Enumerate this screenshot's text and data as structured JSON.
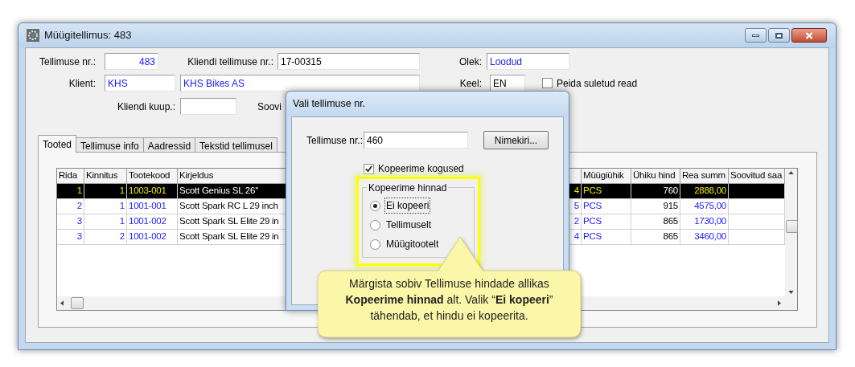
{
  "window": {
    "title": "Müügitellimus: 483"
  },
  "fields": {
    "order_no": {
      "label": "Tellimuse nr.:",
      "value": "483"
    },
    "client_order_no": {
      "label": "Kliendi tellimuse nr.:",
      "value": "17-00315"
    },
    "status": {
      "label": "Olek:",
      "value": "Loodud"
    },
    "client": {
      "label": "Klient:",
      "code": "KHS",
      "name": "KHS Bikes AS"
    },
    "language": {
      "label": "Keel:",
      "value": "EN"
    },
    "hide_closed": {
      "label": "Peida suletud read",
      "checked": false
    },
    "client_date": {
      "label": "Kliendi kuup.:"
    },
    "cut_label": "Soovi"
  },
  "tabs": [
    {
      "label": "Tooted",
      "selected": true
    },
    {
      "label": "Tellimuse info",
      "selected": false
    },
    {
      "label": "Aadressid",
      "selected": false
    },
    {
      "label": "Tekstid tellimusel",
      "selected": false
    }
  ],
  "table": {
    "columns": [
      {
        "label": "Rida",
        "kind": "count"
      },
      {
        "label": "Kinnitus",
        "kind": "count"
      },
      {
        "label": "Tootekood",
        "kind": "code"
      },
      {
        "label": "Kirjeldus",
        "kind": "text"
      },
      {
        "kind": "count"
      },
      {
        "label": "Müügiühik",
        "kind": "code"
      },
      {
        "label": "Ühiku hind",
        "kind": "price"
      },
      {
        "label": "Rea summ",
        "kind": "count"
      },
      {
        "label": "Soovitud saa",
        "kind": "text"
      }
    ],
    "rows": [
      {
        "selected": true,
        "cells": [
          "1",
          "1",
          "1003-001",
          "Scott Genius SL 26''",
          "4",
          "PCS",
          "760",
          "2888,00",
          ""
        ]
      },
      {
        "selected": false,
        "cells": [
          "2",
          "1",
          "1001-001",
          "Scott Spark RC L 29 inch",
          "5",
          "PCS",
          "915",
          "4575,00",
          ""
        ]
      },
      {
        "selected": false,
        "cells": [
          "3",
          "1",
          "1001-002",
          "Scott Spark SL Elite 29 in",
          "2",
          "PCS",
          "865",
          "1730,00",
          ""
        ]
      },
      {
        "selected": false,
        "cells": [
          "3",
          "2",
          "1001-002",
          "Scott Spark SL Elite 29 in",
          "4",
          "PCS",
          "865",
          "3460,00",
          ""
        ]
      }
    ]
  },
  "dialog": {
    "title": "Vali tellimuse nr.",
    "order_label": "Tellimuse nr.:",
    "order_value": "460",
    "list_button": "Nimekiri...",
    "copy_quantities": {
      "label": "Kopeerime kogused",
      "checked": true
    },
    "price_group": {
      "title": "Kopeerime hinnad",
      "options": [
        {
          "label": "Ei kopeeri",
          "selected": true
        },
        {
          "label": "Tellimuselt",
          "selected": false
        },
        {
          "label": "Müügitootelt",
          "selected": false
        }
      ]
    }
  },
  "callout": {
    "text": "Märgista sobiv Tellimuse hindade allikas **Kopeerime hinnad**  alt. Valik “**Ei kopeeri**” tähendab, et hindu ei kopeerita."
  }
}
